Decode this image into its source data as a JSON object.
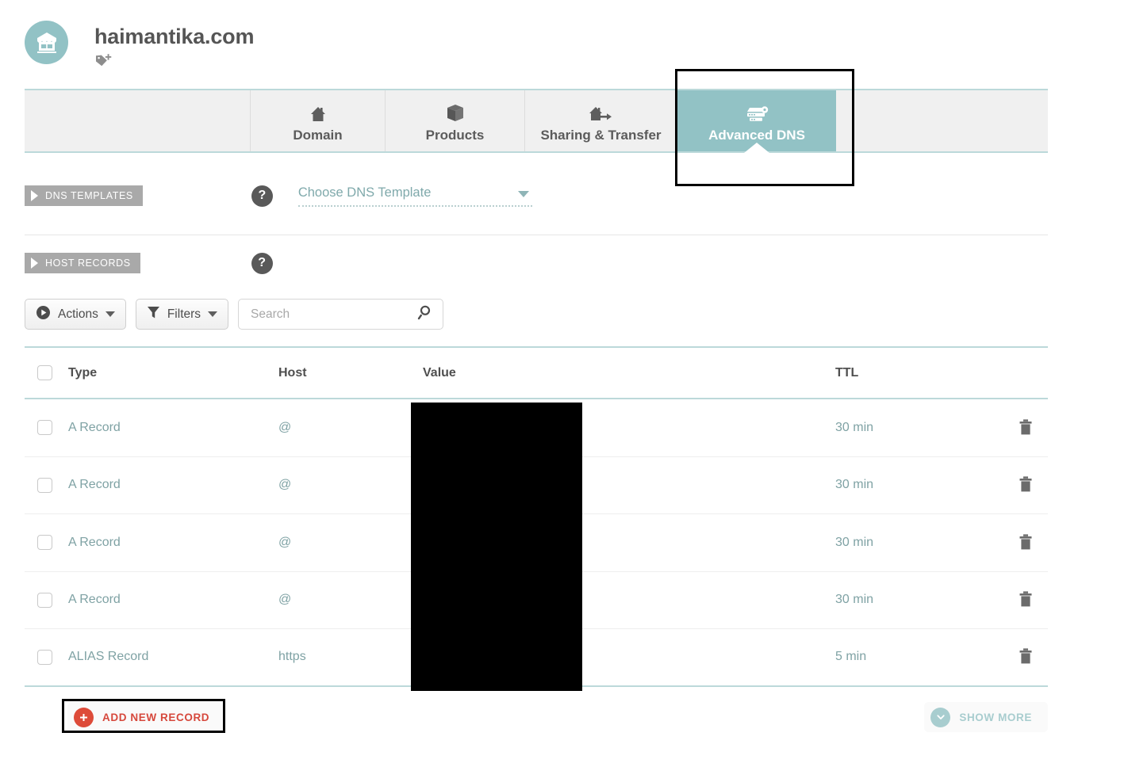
{
  "header": {
    "domain_name": "haimantika.com",
    "store_icon": "storefront-icon",
    "tag_icon": "tag-add-icon"
  },
  "tabs": [
    {
      "label": "Domain",
      "icon": "house-icon",
      "active": false
    },
    {
      "label": "Products",
      "icon": "box-icon",
      "active": false
    },
    {
      "label": "Sharing & Transfer",
      "icon": "house-arrow-icon",
      "active": false
    },
    {
      "label": "Advanced DNS",
      "icon": "server-icon",
      "active": true
    }
  ],
  "sections": {
    "dns_templates": {
      "label": "DNS TEMPLATES",
      "help": "?",
      "select_value": "Choose DNS Template"
    },
    "host_records": {
      "label": "HOST RECORDS",
      "help": "?"
    }
  },
  "toolbar": {
    "actions_label": "Actions",
    "filters_label": "Filters",
    "search_value": "",
    "search_placeholder": "Search"
  },
  "table": {
    "columns": [
      "Type",
      "Host",
      "Value",
      "TTL"
    ],
    "rows": [
      {
        "type": "A Record",
        "host": "@",
        "value": "",
        "ttl": "30 min"
      },
      {
        "type": "A Record",
        "host": "@",
        "value": "",
        "ttl": "30 min"
      },
      {
        "type": "A Record",
        "host": "@",
        "value": "",
        "ttl": "30 min"
      },
      {
        "type": "A Record",
        "host": "@",
        "value": "",
        "ttl": "30 min"
      },
      {
        "type": "ALIAS Record",
        "host": "https",
        "value": "",
        "ttl": "5 min"
      }
    ]
  },
  "footer": {
    "add_new_label": "ADD NEW RECORD",
    "show_more_label": "SHOW MORE"
  },
  "colors": {
    "teal": "#92c2c5",
    "teal_border": "#bcd9da",
    "red": "#dd4b39",
    "tab_bg": "#f0f0f0",
    "ribbon_gray": "#a9a9a9",
    "text_gray": "#5b5b5b",
    "link_teal": "#7fa2a4"
  }
}
